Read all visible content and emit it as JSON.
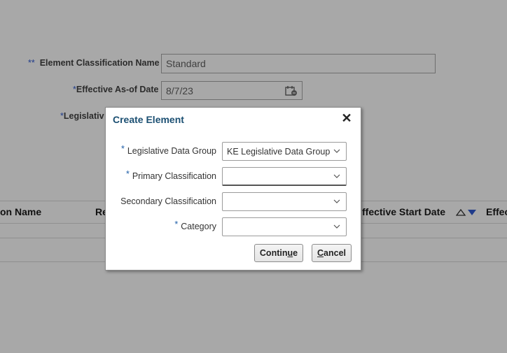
{
  "background": {
    "classification_label": "Element Classification Name",
    "classification_required_marker": "**",
    "classification_value": "Standard",
    "effective_label": "Effective As-of Date",
    "effective_value": "8/7/23",
    "legislative_label": "Legislativ",
    "required_marker": "*",
    "table_headers": {
      "name": "on Name",
      "re": "Re",
      "effective_start": "ffective Start Date",
      "effective_end": "Effec"
    }
  },
  "dialog": {
    "title": "Create Element",
    "close_glyph": "✕",
    "fields": [
      {
        "label": "Legislative Data Group",
        "required": "*",
        "value": "KE Legislative Data Group"
      },
      {
        "label": "Primary Classification",
        "required": "*",
        "value": ""
      },
      {
        "label": "Secondary Classification",
        "required": "",
        "value": ""
      },
      {
        "label": "Category",
        "required": "*",
        "value": ""
      }
    ],
    "continue": {
      "pre": "Contin",
      "accel": "u",
      "post": "e"
    },
    "cancel": {
      "pre": "",
      "accel": "C",
      "post": "ancel"
    }
  },
  "colors": {
    "overlay": "#a8a8a8",
    "title": "#1b4f72",
    "required": "#1f5fa8"
  },
  "icons": [
    "calendar-icon",
    "close-icon",
    "chevron-down-icon",
    "sort-ascending-icon",
    "sort-descending-icon"
  ]
}
